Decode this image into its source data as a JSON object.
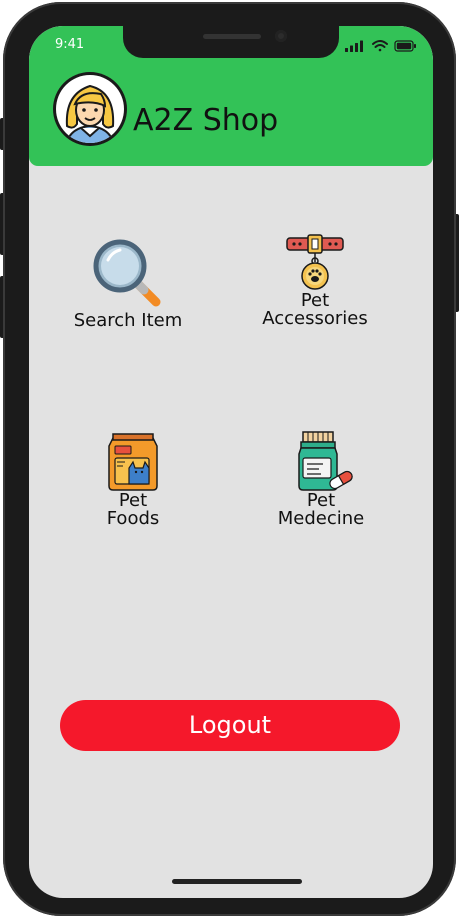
{
  "status_bar": {
    "time": "9:41",
    "icons": [
      "signal-icon",
      "wifi-icon",
      "battery-icon"
    ]
  },
  "header": {
    "title": "A2Z Shop",
    "avatar_icon": "user-avatar-icon",
    "background_color": "#33c257"
  },
  "menu": {
    "items": [
      {
        "label": "Search Item",
        "icon": "magnifier-icon"
      },
      {
        "label": "Pet\nAccessories",
        "icon": "pet-collar-icon"
      },
      {
        "label": "Pet\nFoods",
        "icon": "pet-food-bag-icon"
      },
      {
        "label": "Pet\nMedecine",
        "icon": "medicine-bottle-icon"
      }
    ]
  },
  "actions": {
    "logout_label": "Logout",
    "logout_color": "#f5182b"
  },
  "colors": {
    "screen_background": "#e2e2e2",
    "phone_frame": "#1b1b1b"
  }
}
